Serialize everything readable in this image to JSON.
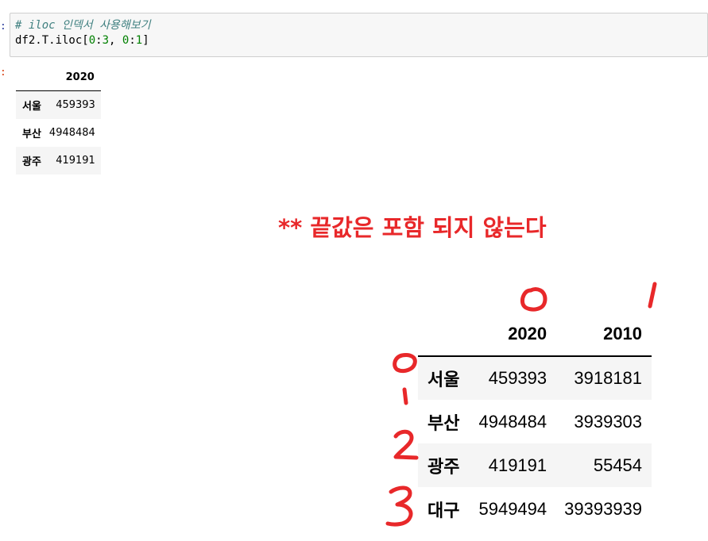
{
  "cell": {
    "input_prompt": ":",
    "output_prompt": ":",
    "comment": "# iloc 인덱서 사용해보기",
    "code_prefix": "df2.T.iloc[",
    "code_num1": "0",
    "code_sep1": ":",
    "code_num2": "3",
    "code_sep2": ", ",
    "code_num3": "0",
    "code_sep3": ":",
    "code_num4": "1",
    "code_suffix": "]"
  },
  "output_table": {
    "columns": [
      "2020"
    ],
    "rows": [
      {
        "index": "서울",
        "values": [
          "459393"
        ]
      },
      {
        "index": "부산",
        "values": [
          "4948484"
        ]
      },
      {
        "index": "광주",
        "values": [
          "419191"
        ]
      }
    ]
  },
  "note": "** 끝값은 포함 되지 않는다",
  "reference_table": {
    "columns": [
      "2020",
      "2010"
    ],
    "rows": [
      {
        "index": "서울",
        "values": [
          "459393",
          "3918181"
        ]
      },
      {
        "index": "부산",
        "values": [
          "4948484",
          "3939303"
        ]
      },
      {
        "index": "광주",
        "values": [
          "419191",
          "55454"
        ]
      },
      {
        "index": "대구",
        "values": [
          "5949494",
          "39393939"
        ]
      }
    ]
  },
  "annotations": {
    "ink_color": "#e8282a",
    "column_numbers": [
      "0",
      "1"
    ],
    "row_numbers": [
      "0",
      "1",
      "2",
      "3"
    ]
  }
}
